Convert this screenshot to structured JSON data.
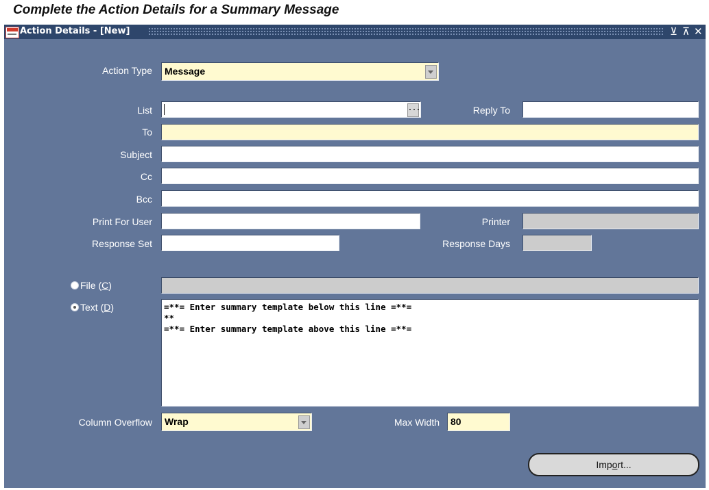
{
  "caption": "Complete the Action Details for a Summary Message",
  "window": {
    "title": "Action Details - [New]",
    "controls": {
      "minimize": "⊻",
      "maximize": "⊼",
      "close": "✕"
    }
  },
  "form": {
    "action_type": {
      "label": "Action Type",
      "value": "Message"
    },
    "list": {
      "label": "List",
      "value": "",
      "lov_label": "..."
    },
    "reply_to": {
      "label": "Reply To",
      "value": ""
    },
    "to": {
      "label": "To",
      "value": ""
    },
    "subject": {
      "label": "Subject",
      "value": ""
    },
    "cc": {
      "label": "Cc",
      "value": ""
    },
    "bcc": {
      "label": "Bcc",
      "value": ""
    },
    "print_for_user": {
      "label": "Print For User",
      "value": ""
    },
    "printer": {
      "label": "Printer",
      "value": ""
    },
    "response_set": {
      "label": "Response Set",
      "value": ""
    },
    "response_days": {
      "label": "Response Days",
      "value": ""
    },
    "file_option": {
      "label_prefix": "File (",
      "accel": "C",
      "label_suffix": ")",
      "selected": false,
      "value": ""
    },
    "text_option": {
      "label_prefix": "Text (",
      "accel": "D",
      "label_suffix": ")",
      "selected": true
    },
    "text_body": "=**= Enter summary template below this line =**=\n**\n=**= Enter summary template above this line =**=",
    "column_overflow": {
      "label": "Column Overflow",
      "value": "Wrap"
    },
    "max_width": {
      "label": "Max Width",
      "value": "80"
    }
  },
  "import_button": {
    "prefix": "Imp",
    "accel": "o",
    "suffix": "rt..."
  },
  "colors": {
    "window_bg": "#627699",
    "titlebar": "#2e466b",
    "required_field": "#fffad0",
    "disabled_field": "#cccccc"
  }
}
